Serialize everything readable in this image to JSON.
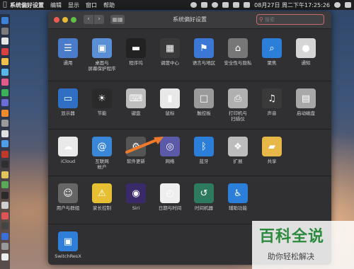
{
  "menubar": {
    "apple_icon": "apple-icon",
    "items": [
      "系统偏好设置",
      "编辑",
      "显示",
      "窗口",
      "帮助"
    ],
    "clock": "08月27日 周二下午17:25:26"
  },
  "window": {
    "title": "系统偏好设置",
    "search_placeholder": "搜索"
  },
  "rows": [
    [
      {
        "label": "通用",
        "icon": "file-icon",
        "color": "#4a7cc9"
      },
      {
        "label": "桌面与\n屏幕保护程序",
        "icon": "desktop-icon",
        "color": "#5a8fd6"
      },
      {
        "label": "程序坞",
        "icon": "dock-icon",
        "color": "#222"
      },
      {
        "label": "调度中心",
        "icon": "mission-control-icon",
        "color": "#3a3a3a"
      },
      {
        "label": "语言与地区",
        "icon": "flag-icon",
        "color": "#3b78d6"
      },
      {
        "label": "安全性与隐私",
        "icon": "house-icon",
        "color": "#777"
      },
      {
        "label": "聚焦",
        "icon": "magnifier-icon",
        "color": "#2b7fd8"
      },
      {
        "label": "通知",
        "icon": "notifications-icon",
        "color": "#d6d6d6"
      }
    ],
    [
      {
        "label": "显示器",
        "icon": "monitor-icon",
        "color": "#2f6fc4"
      },
      {
        "label": "节能",
        "icon": "bulb-icon",
        "color": "#2a2a2a"
      },
      {
        "label": "键盘",
        "icon": "keyboard-icon",
        "color": "#bdbdbd"
      },
      {
        "label": "鼠标",
        "icon": "mouse-icon",
        "color": "#e8e8e8"
      },
      {
        "label": "触控板",
        "icon": "trackpad-icon",
        "color": "#9a9a9a"
      },
      {
        "label": "打印机与\n扫描仪",
        "icon": "printer-icon",
        "color": "#b0b0b0"
      },
      {
        "label": "声音",
        "icon": "speaker-icon",
        "color": "#3a3a3a"
      },
      {
        "label": "启动磁盘",
        "icon": "disk-icon",
        "color": "#a8a8a8"
      }
    ],
    [
      {
        "label": "iCloud",
        "icon": "cloud-icon",
        "color": "#e9e9e9"
      },
      {
        "label": "互联网\n帐户",
        "icon": "at-icon",
        "color": "#3a86d8"
      },
      {
        "label": "软件更新",
        "icon": "gear-icon",
        "color": "#555"
      },
      {
        "label": "网络",
        "icon": "globe-icon",
        "color": "#5a5aa8"
      },
      {
        "label": "蓝牙",
        "icon": "bluetooth-icon",
        "color": "#2b7fd8"
      },
      {
        "label": "扩展",
        "icon": "puzzle-icon",
        "color": "#bcbcbc"
      },
      {
        "label": "共享",
        "icon": "folder-icon",
        "color": "#e7b748"
      }
    ],
    [
      {
        "label": "用户与群组",
        "icon": "users-icon",
        "color": "#666"
      },
      {
        "label": "家长控制",
        "icon": "parental-icon",
        "color": "#e6c032"
      },
      {
        "label": "Siri",
        "icon": "siri-icon",
        "color": "#3a2a6a"
      },
      {
        "label": "日期与时间",
        "icon": "clock-icon",
        "color": "#eeeeee"
      },
      {
        "label": "时间机器",
        "icon": "time-machine-icon",
        "color": "#2e7a5e"
      },
      {
        "label": "辅助功能",
        "icon": "accessibility-icon",
        "color": "#2b7fd8"
      }
    ],
    [
      {
        "label": "SwitchResX",
        "icon": "switchresx-icon",
        "color": "#2f7fd8"
      }
    ]
  ],
  "watermark": {
    "big": "百科全说",
    "small": "助你轻松解决"
  },
  "colors": {
    "accent_arrow": "#f07a2a",
    "search_border": "#c96a6a"
  }
}
